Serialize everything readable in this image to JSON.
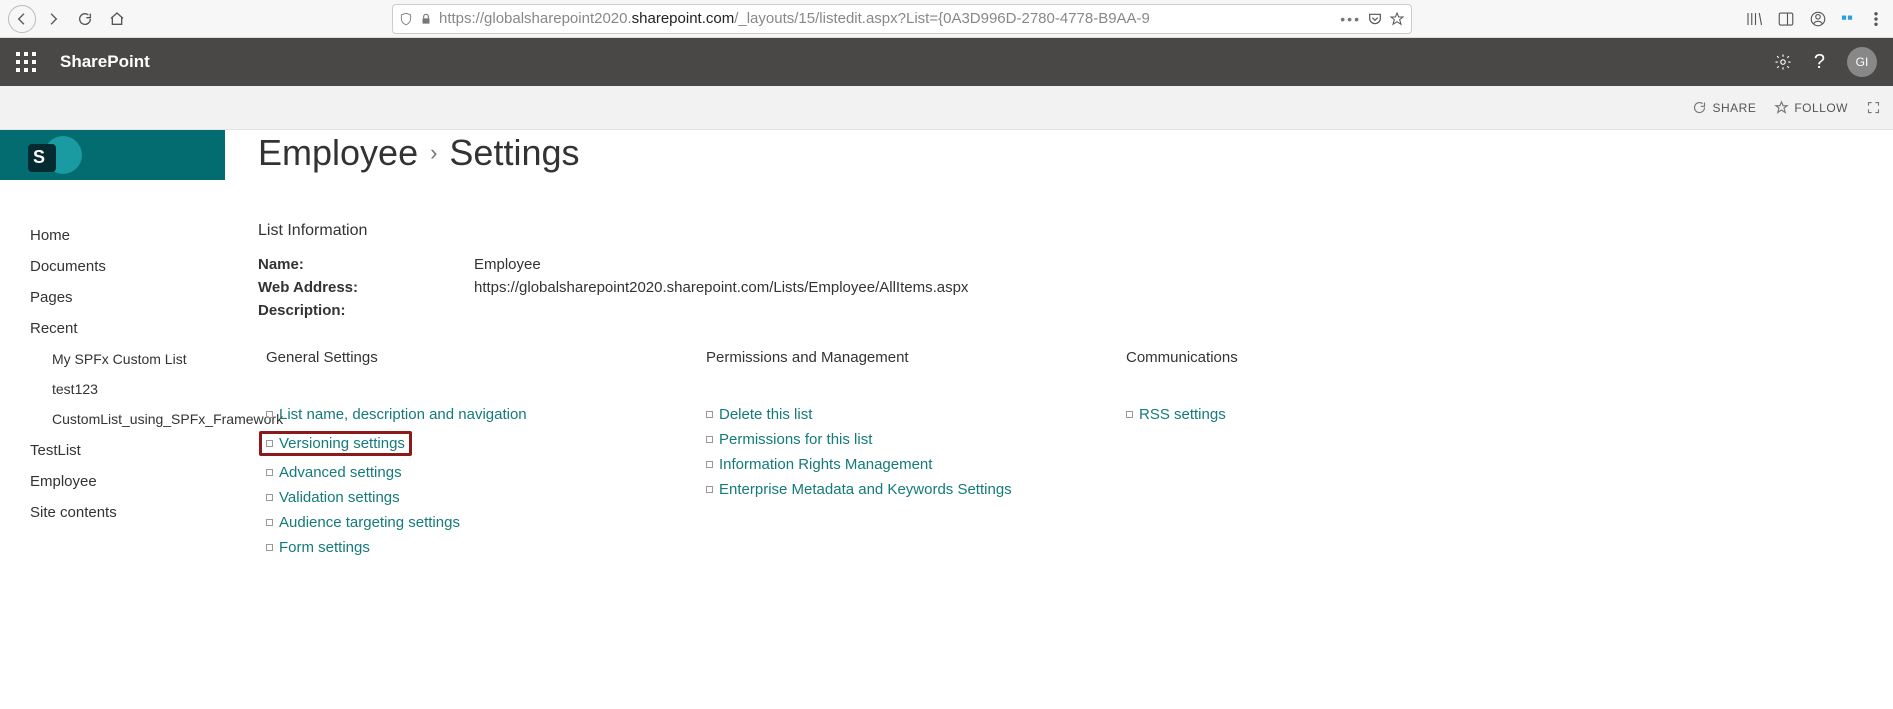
{
  "browser": {
    "url_prefix": "https://globalsharepoint2020.",
    "url_domain": "sharepoint.com",
    "url_suffix": "/_layouts/15/listedit.aspx?List={0A3D996D-2780-4778-B9AA-9"
  },
  "suite": {
    "title": "SharePoint",
    "avatar": "GI"
  },
  "page_actions": {
    "share": "SHARE",
    "follow": "FOLLOW"
  },
  "site_logo_letter": "S",
  "breadcrumb": {
    "list": "Employee",
    "page": "Settings"
  },
  "nav": {
    "items": [
      "Home",
      "Documents",
      "Pages",
      "Recent"
    ],
    "recent": [
      "My SPFx Custom List",
      "test123",
      "CustomList_using_SPFx_Framework"
    ],
    "after": [
      "TestList",
      "Employee",
      "Site contents"
    ]
  },
  "list_info": {
    "heading": "List Information",
    "name_label": "Name:",
    "name_value": "Employee",
    "web_label": "Web Address:",
    "web_value": "https://globalsharepoint2020.sharepoint.com/Lists/Employee/AllItems.aspx",
    "desc_label": "Description:"
  },
  "columns": {
    "general": {
      "heading": "General Settings",
      "links": [
        "List name, description and navigation",
        "Versioning settings",
        "Advanced settings",
        "Validation settings",
        "Audience targeting settings",
        "Form settings"
      ]
    },
    "perm": {
      "heading": "Permissions and Management",
      "links": [
        "Delete this list",
        "Permissions for this list",
        "Information Rights Management",
        "Enterprise Metadata and Keywords Settings"
      ]
    },
    "comm": {
      "heading": "Communications",
      "links": [
        "RSS settings"
      ]
    }
  }
}
